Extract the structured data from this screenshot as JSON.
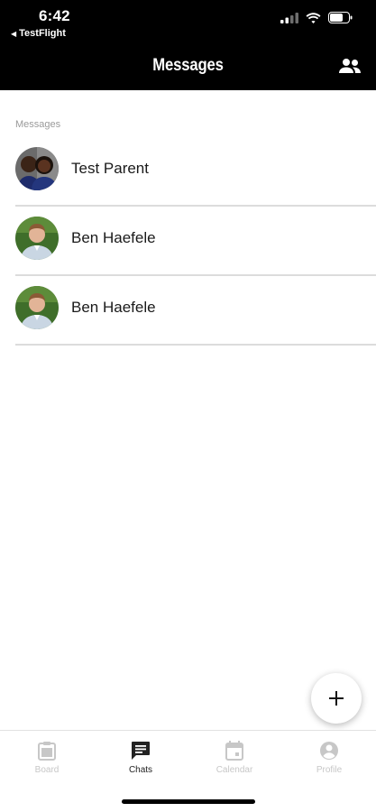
{
  "status_bar": {
    "time": "6:42",
    "back_app": "TestFlight",
    "icons": [
      "cellular-signal-icon",
      "wifi-icon",
      "battery-icon"
    ]
  },
  "header": {
    "title": "Messages",
    "group_icon": "people-icon"
  },
  "section_label": "Messages",
  "conversations": [
    {
      "name": "Test Parent",
      "avatar": "avatar-couple"
    },
    {
      "name": "Ben Haefele",
      "avatar": "avatar-man"
    },
    {
      "name": "Ben Haefele",
      "avatar": "avatar-man"
    }
  ],
  "fab": {
    "icon": "plus-icon"
  },
  "bottom_nav": {
    "items": [
      {
        "label": "Board",
        "icon": "board-icon",
        "active": false
      },
      {
        "label": "Chats",
        "icon": "chat-icon",
        "active": true
      },
      {
        "label": "Calendar",
        "icon": "calendar-icon",
        "active": false
      },
      {
        "label": "Profile",
        "icon": "profile-icon",
        "active": false
      }
    ]
  },
  "colors": {
    "header_bg": "#000000",
    "active_nav": "#222222",
    "inactive_nav": "#c7c7c7",
    "divider": "#dcdcdc"
  }
}
